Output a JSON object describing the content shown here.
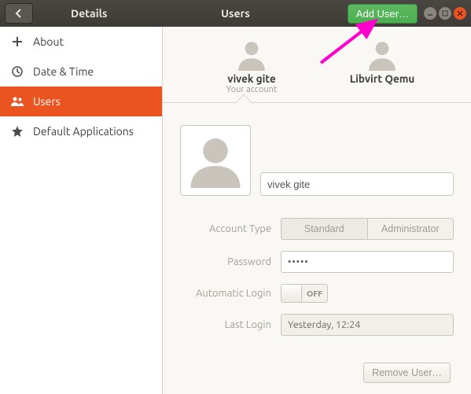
{
  "titlebar": {
    "left_title": "Details",
    "center_title": "Users",
    "add_user_label": "Add User…"
  },
  "sidebar": {
    "items": [
      {
        "label": "About"
      },
      {
        "label": "Date & Time"
      },
      {
        "label": "Users"
      },
      {
        "label": "Default Applications"
      }
    ]
  },
  "users_row": [
    {
      "name": "vivek gite",
      "subtitle": "Your account"
    },
    {
      "name": "Libvirt Qemu",
      "subtitle": ""
    }
  ],
  "detail": {
    "name_value": "vivek gite",
    "account_type_label": "Account Type",
    "account_type_options": {
      "standard": "Standard",
      "admin": "Administrator"
    },
    "password_label": "Password",
    "password_value": "•••••",
    "autologin_label": "Automatic Login",
    "autologin_state": "OFF",
    "lastlogin_label": "Last Login",
    "lastlogin_value": "Yesterday, 12:24"
  },
  "footer": {
    "remove_label": "Remove User…"
  },
  "colors": {
    "accent": "#e95420",
    "add_btn": "#4caf50"
  }
}
